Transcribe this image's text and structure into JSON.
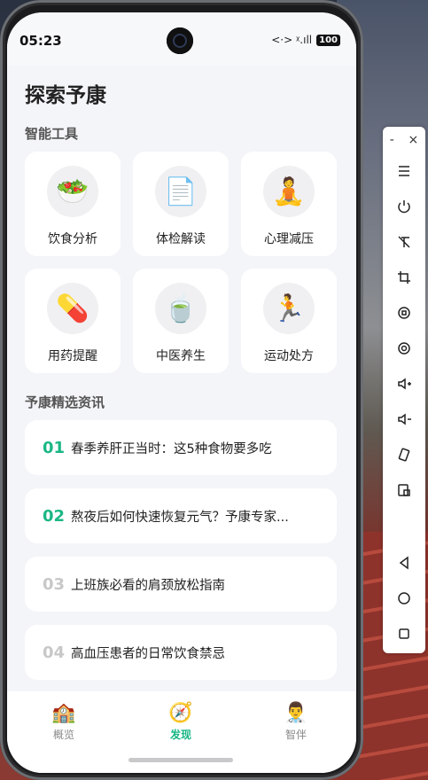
{
  "status": {
    "time": "05:23",
    "battery": "100",
    "network": "<·> ᵡ.ıll"
  },
  "title": "探索予康",
  "tools_title": "智能工具",
  "tools": [
    {
      "label": "饮食分析",
      "icon": "🥗"
    },
    {
      "label": "体检解读",
      "icon": "📄"
    },
    {
      "label": "心理减压",
      "icon": "🧘"
    },
    {
      "label": "用药提醒",
      "icon": "💊"
    },
    {
      "label": "中医养生",
      "icon": "🍵"
    },
    {
      "label": "运动处方",
      "icon": "🏃"
    }
  ],
  "news_title": "予康精选资讯",
  "news": [
    {
      "num": "01",
      "text": "春季养肝正当时：这5种食物要多吃",
      "color": "#1bb785"
    },
    {
      "num": "02",
      "text": "熬夜后如何快速恢复元气？予康专家...",
      "color": "#1bb785"
    },
    {
      "num": "03",
      "text": "上班族必看的肩颈放松指南",
      "color": "#c8c8c8"
    },
    {
      "num": "04",
      "text": "高血压患者的日常饮食禁忌",
      "color": "#c8c8c8"
    }
  ],
  "tabs": [
    {
      "label": "概览",
      "icon": "🏫"
    },
    {
      "label": "发现",
      "icon": "🧭"
    },
    {
      "label": "智伴",
      "icon": "👨‍⚕️"
    }
  ],
  "accent": "#1bb785",
  "panel": {
    "minimize": "-",
    "close": "×"
  }
}
